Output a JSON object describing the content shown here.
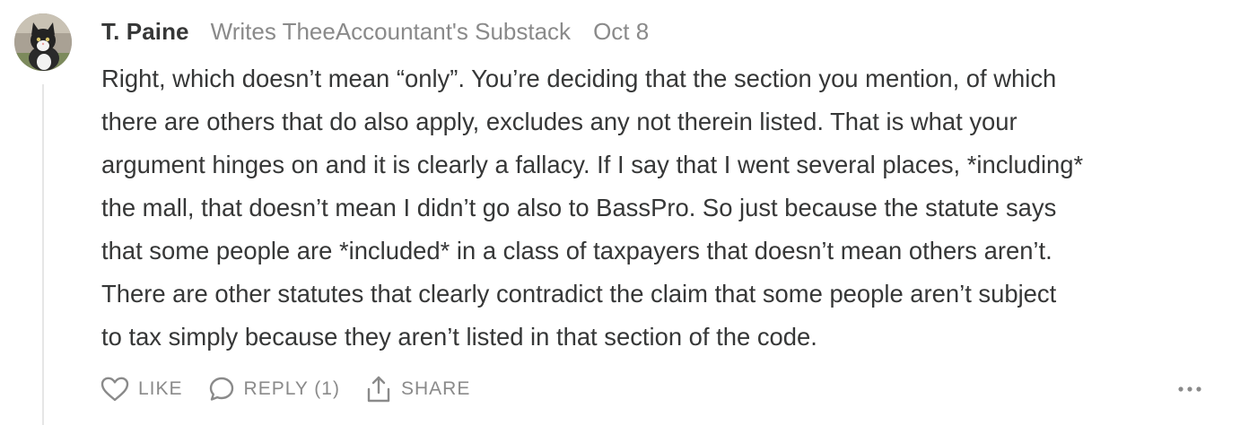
{
  "comment": {
    "author": "T. Paine",
    "byline": "Writes TheeAccountant's Substack",
    "date": "Oct 8",
    "body_lines": [
      "Right, which doesn’t mean “only”. You’re deciding that the section you mention, of which",
      "there are others that do also apply, excludes any not therein listed. That is what your",
      "argument hinges on and it is clearly a fallacy. If I say that I went several places, *including*",
      "the mall, that doesn’t mean I didn’t go also to BassPro. So just because the statute says",
      "that some people are *included* in a class of taxpayers that doesn’t mean others aren’t.",
      "There are other statutes that clearly contradict the claim that some people aren’t subject",
      "to tax simply because they aren’t listed in that section of the code."
    ],
    "actions": {
      "like_label": "LIKE",
      "reply_label": "REPLY (1)",
      "share_label": "SHARE"
    },
    "icons": {
      "avatar": "cat-avatar",
      "like": "heart-icon",
      "reply": "speech-bubble-icon",
      "share": "share-upload-icon",
      "more": "ellipsis-icon"
    }
  },
  "colors": {
    "text": "#363737",
    "muted": "#8a8a8a",
    "thread_line": "#e6e6e6",
    "background": "#ffffff"
  }
}
